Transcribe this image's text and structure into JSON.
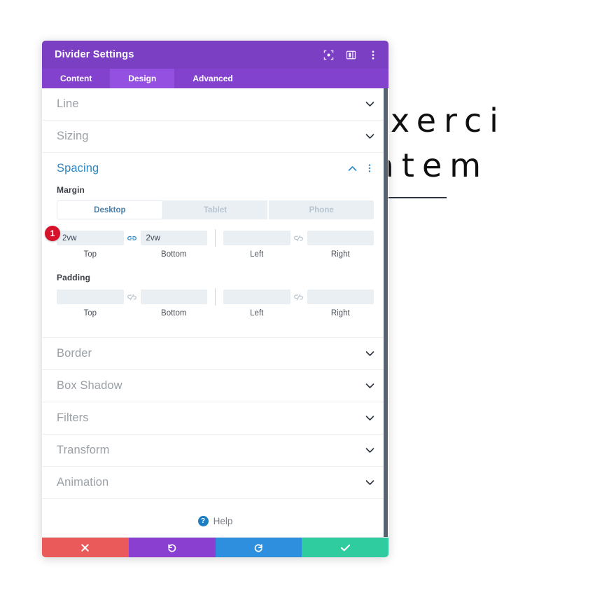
{
  "background": {
    "heading_line1": "d Exerci",
    "heading_line2": "ritatem",
    "divider_color": "#2b3640"
  },
  "modal": {
    "title": "Divider Settings",
    "header_icons": [
      {
        "name": "focus-icon",
        "label": "Focus"
      },
      {
        "name": "layout-toggle-icon",
        "label": "Layout"
      },
      {
        "name": "more-options-icon",
        "label": "More"
      }
    ],
    "tabs": [
      {
        "label": "Content",
        "active": false
      },
      {
        "label": "Design",
        "active": true
      },
      {
        "label": "Advanced",
        "active": false
      }
    ],
    "accent_color": "#7b3fc4",
    "tabs_bg": "#8342cd",
    "tab_active_bg": "#9450e0",
    "sections_before": [
      {
        "label": "Line"
      },
      {
        "label": "Sizing"
      }
    ],
    "open_section": {
      "label": "Spacing",
      "title_color": "#2e87c4",
      "fields": [
        {
          "label": "Margin",
          "badge": "1",
          "devices": [
            {
              "label": "Desktop",
              "active": true
            },
            {
              "label": "Tablet",
              "active": false
            },
            {
              "label": "Phone",
              "active": false
            }
          ],
          "inputs": [
            {
              "caption": "Top",
              "value": "2vw",
              "placeholder": ""
            },
            {
              "caption": "Bottom",
              "value": "2vw",
              "placeholder": ""
            },
            {
              "caption": "Left",
              "value": "",
              "placeholder": ""
            },
            {
              "caption": "Right",
              "value": "",
              "placeholder": ""
            }
          ],
          "link_left": "linked",
          "link_right": "unlinked"
        },
        {
          "label": "Padding",
          "badge": "",
          "inputs": [
            {
              "caption": "Top",
              "value": "",
              "placeholder": ""
            },
            {
              "caption": "Bottom",
              "value": "",
              "placeholder": ""
            },
            {
              "caption": "Left",
              "value": "",
              "placeholder": ""
            },
            {
              "caption": "Right",
              "value": "",
              "placeholder": ""
            }
          ],
          "link_left": "unlinked",
          "link_right": "unlinked"
        }
      ]
    },
    "sections_after": [
      {
        "label": "Border"
      },
      {
        "label": "Box Shadow"
      },
      {
        "label": "Filters"
      },
      {
        "label": "Transform"
      },
      {
        "label": "Animation"
      }
    ],
    "help": {
      "label": "Help",
      "icon_glyph": "?"
    },
    "footer_actions": [
      {
        "name": "cancel-button",
        "icon": "close-icon",
        "color": "#ea5a5a"
      },
      {
        "name": "undo-button",
        "icon": "undo-icon",
        "color": "#8b3fd1"
      },
      {
        "name": "redo-button",
        "icon": "redo-icon",
        "color": "#2d8fdd"
      },
      {
        "name": "save-button",
        "icon": "check-icon",
        "color": "#2fcc9f"
      }
    ]
  }
}
